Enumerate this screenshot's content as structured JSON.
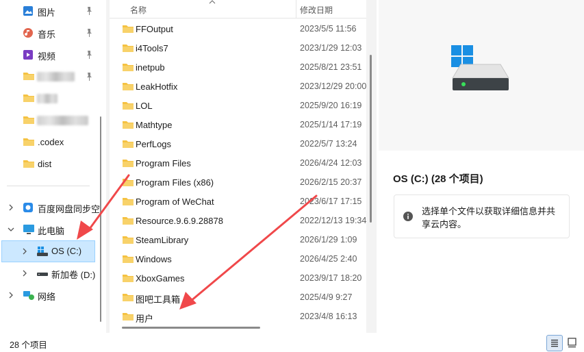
{
  "nav": {
    "quick_access": [
      {
        "label": "图片",
        "icon": "pictures-icon",
        "pinned": true
      },
      {
        "label": "音乐",
        "icon": "music-icon",
        "pinned": true
      },
      {
        "label": "视频",
        "icon": "videos-icon",
        "pinned": true
      },
      {
        "label": "",
        "icon": "folder-icon",
        "pinned": true,
        "blurred": true
      },
      {
        "label": "",
        "icon": "folder-icon",
        "pinned": false,
        "blurred": true
      },
      {
        "label": "",
        "icon": "folder-icon",
        "pinned": false,
        "blurred": true
      },
      {
        "label": ".codex",
        "icon": "folder-icon",
        "pinned": false
      },
      {
        "label": "dist",
        "icon": "folder-icon",
        "pinned": false
      }
    ],
    "tree": [
      {
        "label": "百度网盘同步空",
        "icon": "baidu-sync-icon"
      },
      {
        "label": "此电脑",
        "icon": "this-pc-icon"
      },
      {
        "label": "OS (C:)",
        "icon": "windows-drive-icon"
      },
      {
        "label": "新加卷 (D:)",
        "icon": "drive-icon"
      },
      {
        "label": "网络",
        "icon": "network-icon"
      }
    ]
  },
  "columns": {
    "name": "名称",
    "date": "修改日期"
  },
  "files": [
    {
      "name": "FFOutput",
      "date": "2023/5/5 11:56"
    },
    {
      "name": "i4Tools7",
      "date": "2023/1/29 12:03"
    },
    {
      "name": "inetpub",
      "date": "2025/8/21 23:51"
    },
    {
      "name": "LeakHotfix",
      "date": "2023/12/29 20:00"
    },
    {
      "name": "LOL",
      "date": "2025/9/20 16:19"
    },
    {
      "name": "Mathtype",
      "date": "2025/1/14 17:19"
    },
    {
      "name": "PerfLogs",
      "date": "2022/5/7 13:24"
    },
    {
      "name": "Program Files",
      "date": "2026/4/24 12:03"
    },
    {
      "name": "Program Files (x86)",
      "date": "2026/2/15 20:37"
    },
    {
      "name": "Program of WeChat",
      "date": "2023/6/17 17:15"
    },
    {
      "name": "Resource.9.6.9.28878",
      "date": "2022/12/13 19:34"
    },
    {
      "name": "SteamLibrary",
      "date": "2026/1/29 1:09"
    },
    {
      "name": "Windows",
      "date": "2026/4/25 2:40"
    },
    {
      "name": "XboxGames",
      "date": "2023/9/17 18:20"
    },
    {
      "name": "图吧工具箱",
      "date": "2025/4/9 9:27"
    },
    {
      "name": "用户",
      "date": "2023/4/8 16:13"
    }
  ],
  "details": {
    "title": "OS (C:) (28 个项目)",
    "info": "选择单个文件以获取详细信息并共享云内容。"
  },
  "status": {
    "item_count": "28 个项目"
  },
  "colors": {
    "folder": "#f5c242",
    "selection": "#cce8ff",
    "arrow": "#f0484a"
  }
}
